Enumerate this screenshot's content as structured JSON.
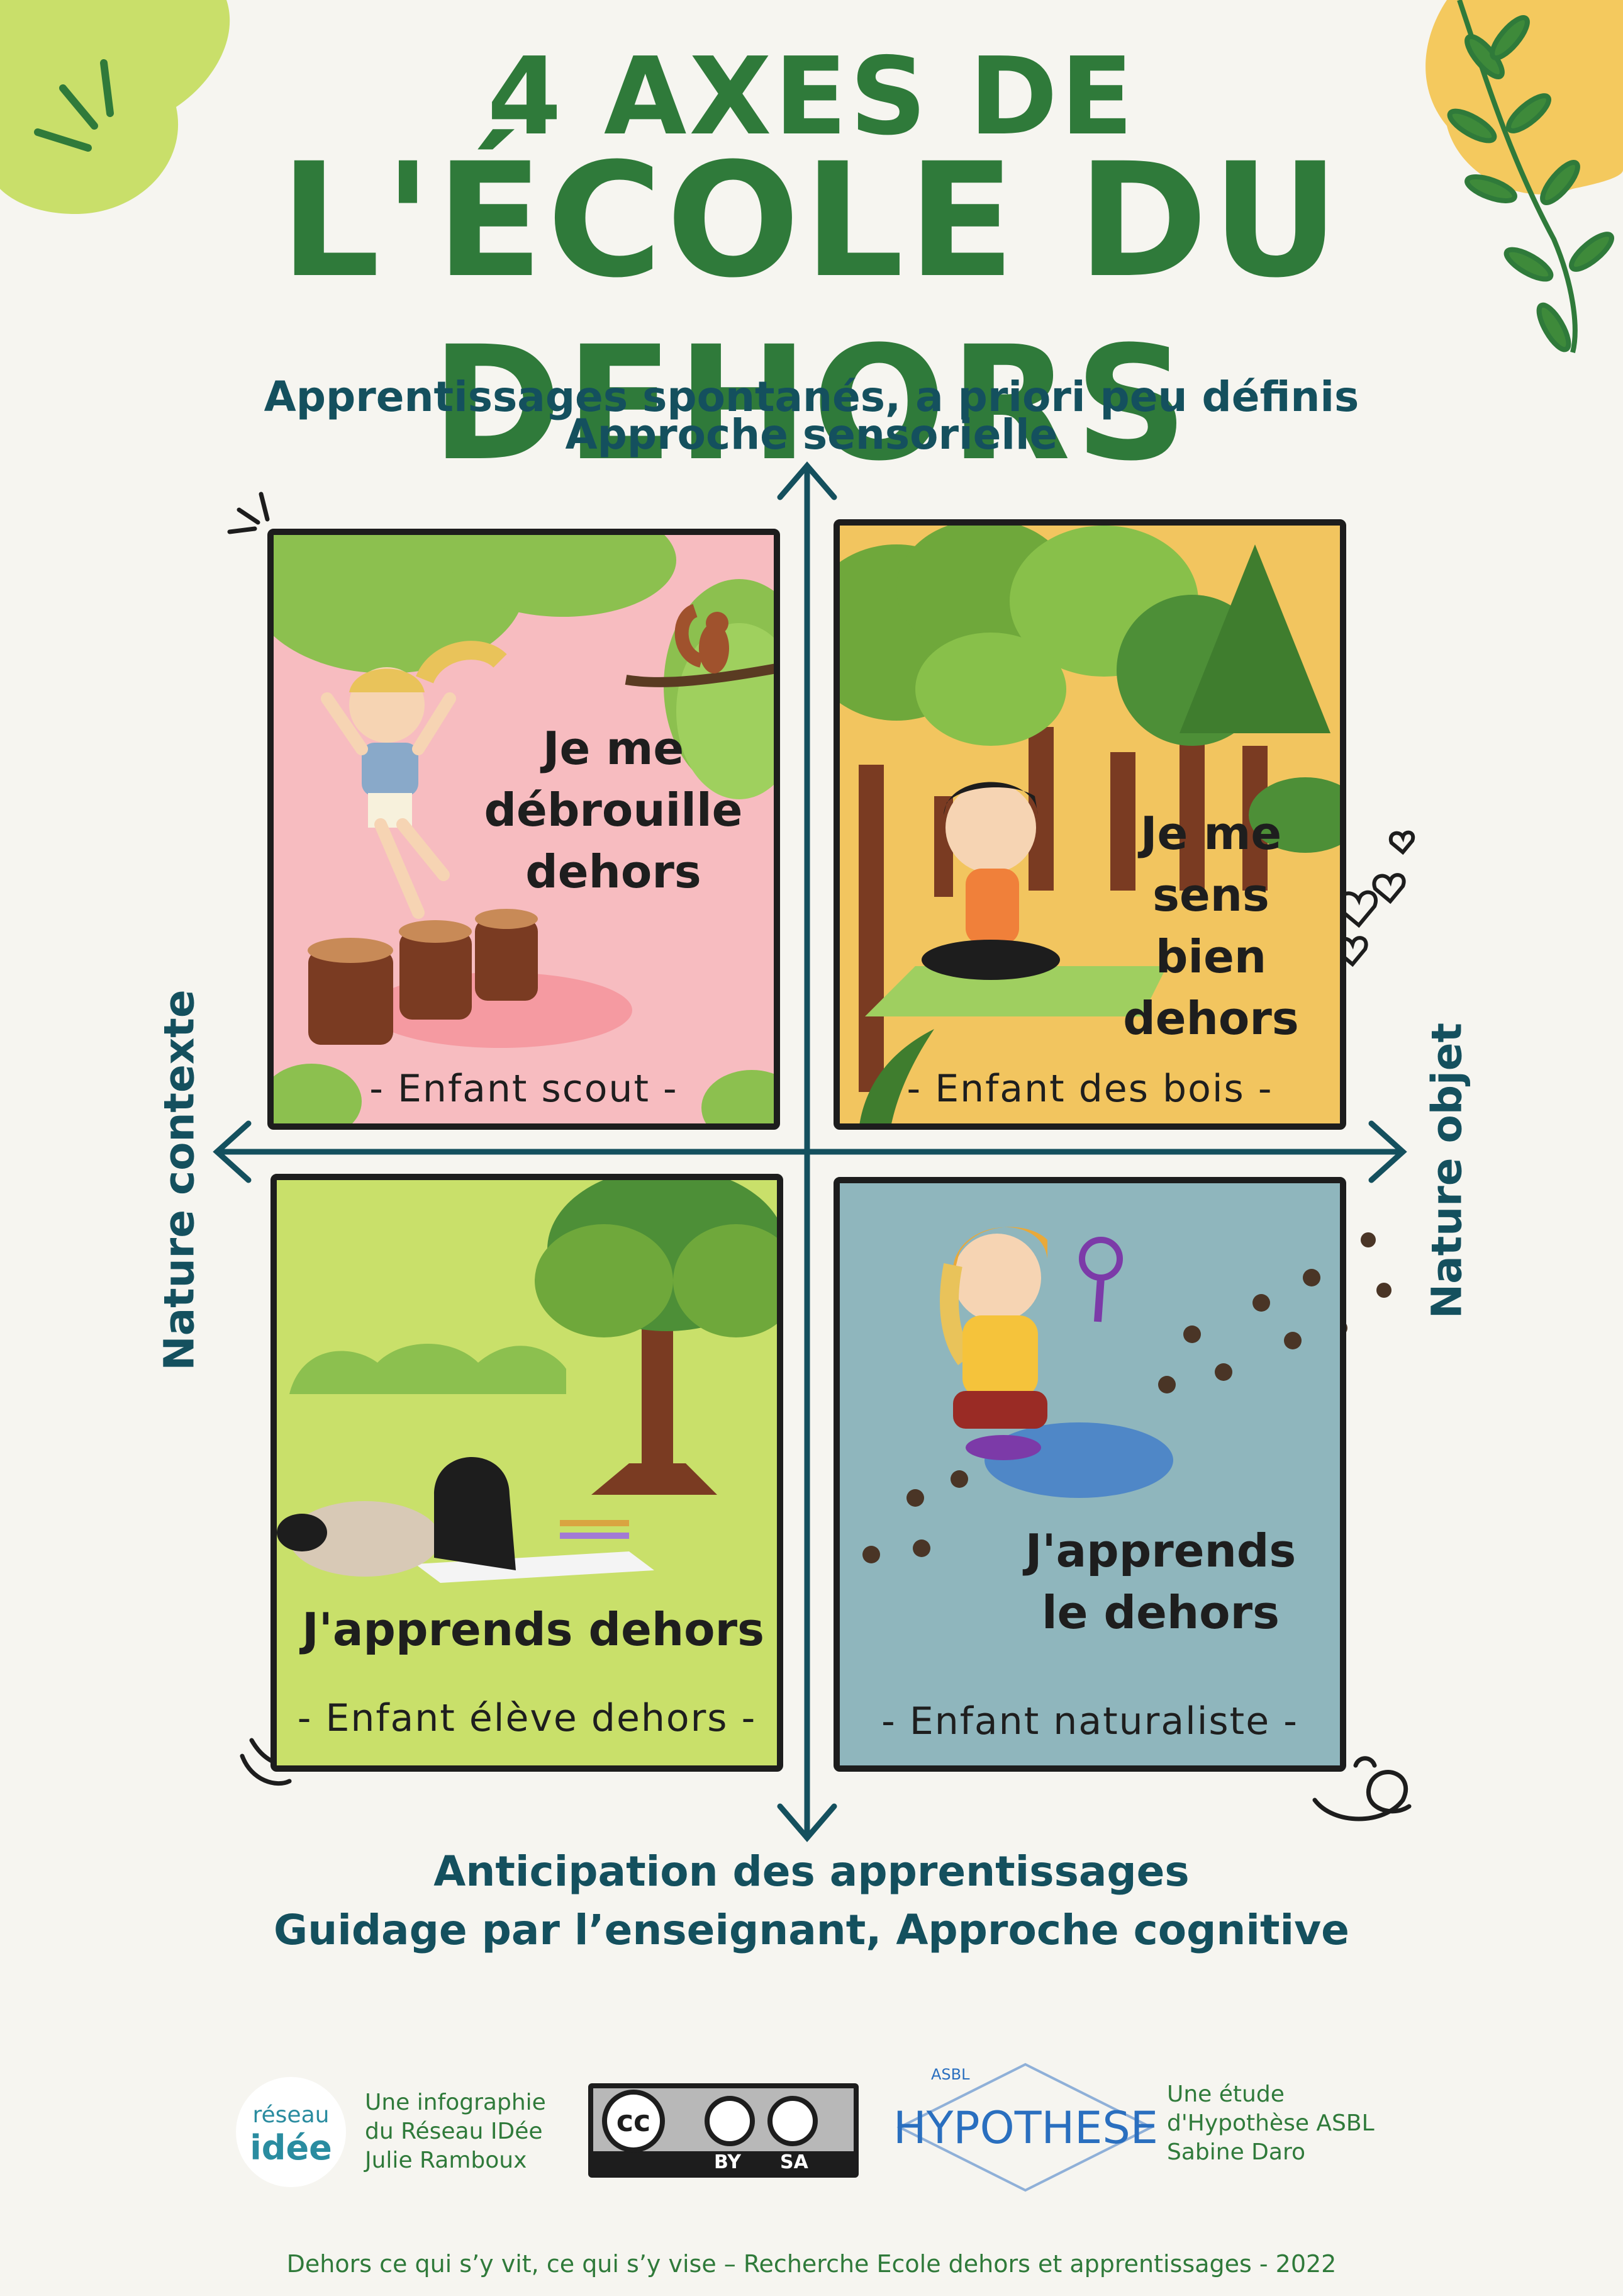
{
  "title": {
    "line1": "4 AXES DE",
    "line2": "L'ÉCOLE DU DEHORS"
  },
  "axes": {
    "top_line1": "Apprentissages spontanés, a priori peu définis",
    "top_line2": "Approche sensorielle",
    "bottom_line1": "Anticipation des apprentissages",
    "bottom_line2": "Guidage par l’enseignant, Approche cognitive",
    "left": "Nature contexte",
    "right": "Nature objet"
  },
  "quadrants": [
    {
      "phrase_lines": [
        "Je me",
        "débrouille",
        "dehors"
      ],
      "caption": "- Enfant scout -",
      "bg": "#f7bcc0"
    },
    {
      "phrase_lines": [
        "Je me",
        "sens",
        "bien",
        "dehors"
      ],
      "caption": "- Enfant des bois -",
      "bg": "#f2c55f"
    },
    {
      "phrase_lines": [
        "J'apprends dehors"
      ],
      "caption": "- Enfant élève dehors -",
      "bg": "#c9e06a"
    },
    {
      "phrase_lines": [
        "J'apprends",
        "le dehors"
      ],
      "caption": "- Enfant naturaliste -",
      "bg": "#8fb6bd"
    }
  ],
  "footer": {
    "reseau_logo": {
      "line1": "réseau",
      "line2": "idée"
    },
    "reseau_text": [
      "Une infographie",
      "du Réseau IDée",
      "Julie Ramboux"
    ],
    "cc_badge": {
      "by": "BY",
      "sa": "SA"
    },
    "hypothese_logo": {
      "small": "ASBL",
      "main": "HYPOTHESE"
    },
    "hypothese_text": [
      "Une étude",
      "d'Hypothèse ASBL",
      "Sabine Daro"
    ],
    "bottom": "Dehors ce qui s’y vit, ce qui s’y vise – Recherche Ecole dehors et apprentissages - 2022"
  },
  "colors": {
    "title_green": "#2f7a3a",
    "axis_blue": "#14505e",
    "page_bg": "#f6f5f0"
  }
}
